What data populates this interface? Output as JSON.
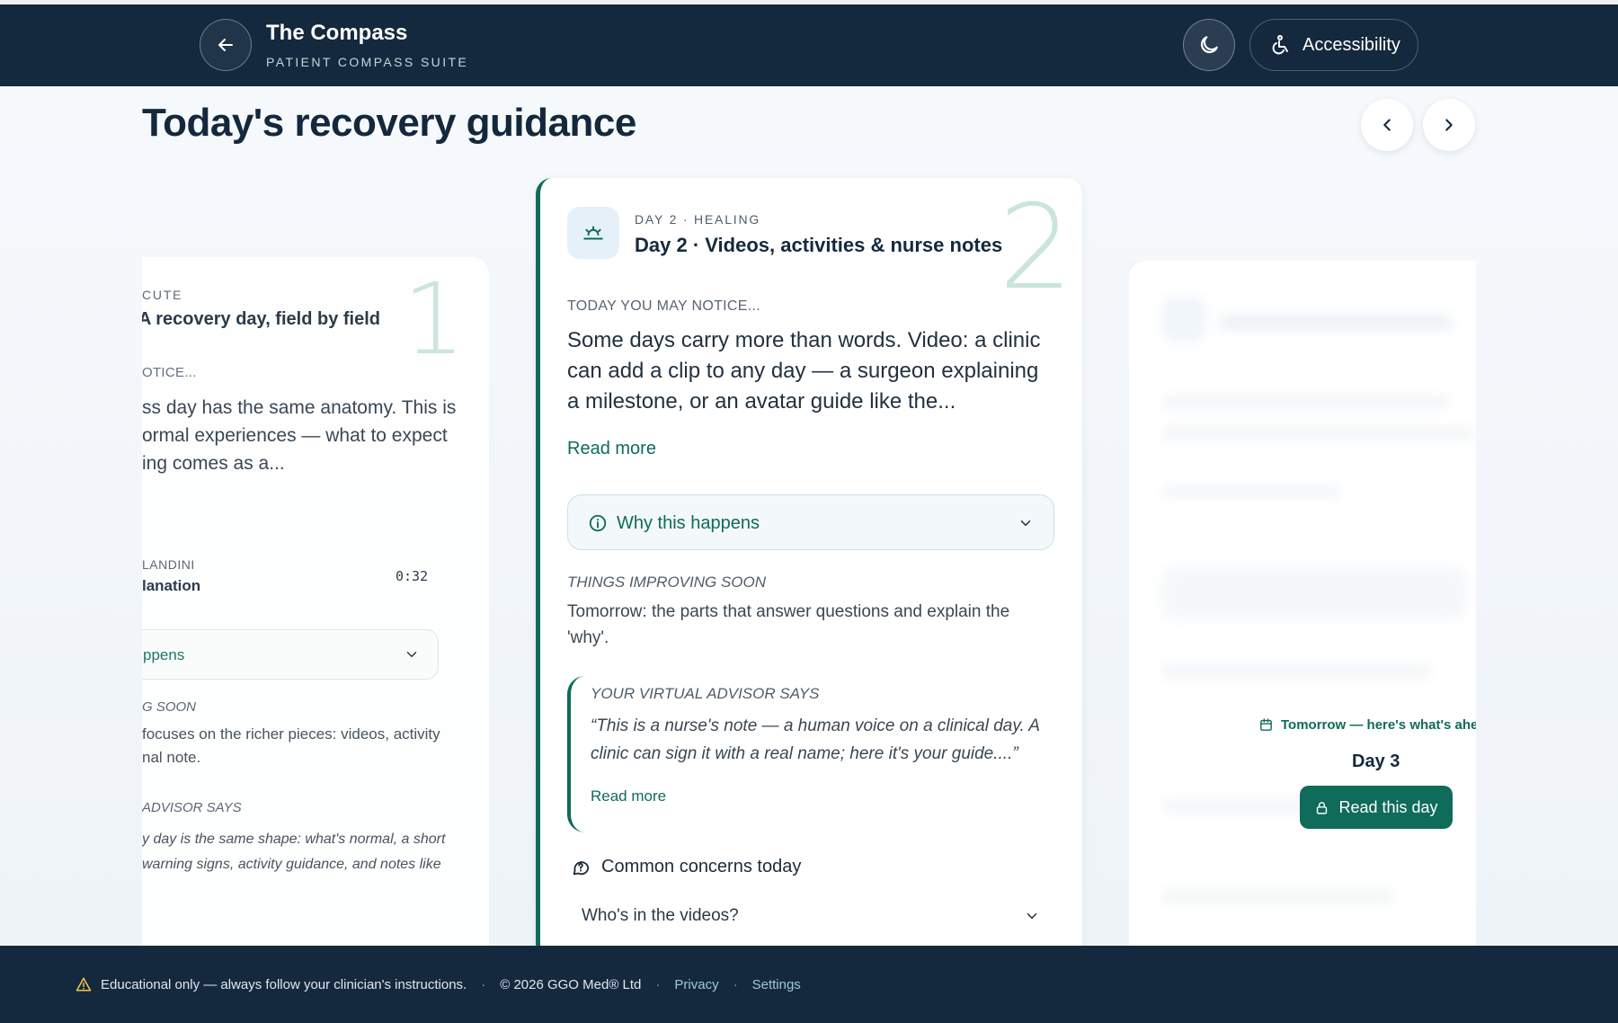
{
  "header": {
    "title": "The Compass",
    "subtitle": "PATIENT COMPASS SUITE",
    "accessibility_label": "Accessibility"
  },
  "page": {
    "title": "Today's recovery guidance"
  },
  "left_card": {
    "eyebrow": "CUTE",
    "title": "A recovery day, field by field",
    "big_number": "1",
    "notice_label": "OTICE...",
    "body_line1": "ss day has the same anatomy. This is",
    "body_line2": "ormal experiences — what to expect",
    "body_line3": "ing comes as a...",
    "video_author": "LANDINI",
    "video_title": "lanation",
    "video_time": "0:32",
    "why_label": "ppens",
    "improving_label": "G SOON",
    "improving_line1": "focuses on the richer pieces: videos, activity",
    "improving_line2": "nal note.",
    "advisor_label": "ADVISOR SAYS",
    "advisor_line1": "y day is the same shape: what's normal, a short",
    "advisor_line2": "warning signs, activity guidance, and notes like"
  },
  "center_card": {
    "eyebrow": "DAY 2 · HEALING",
    "title": "Day 2 · Videos, activities & nurse notes",
    "big_number": "2",
    "notice_label": "TODAY YOU MAY NOTICE...",
    "notice_text": "Some days carry more than words. Video: a clinic can add a clip to any day — a surgeon explaining a milestone, or an avatar guide like the...",
    "read_more": "Read more",
    "why_label": "Why this happens",
    "improving_label": "THINGS IMPROVING SOON",
    "improving_text": "Tomorrow: the parts that answer questions and explain the 'why'.",
    "advisor_label": "YOUR VIRTUAL ADVISOR SAYS",
    "advisor_quote": "“This is a nurse's note — a human voice on a clinical day. A clinic can sign it with a real name; here it's your guide....”",
    "advisor_read_more": "Read more",
    "concerns_label": "Common concerns today",
    "concern_1": "Who's in the videos?"
  },
  "right_card": {
    "tomorrow_label": "Tomorrow — here's what's ahe",
    "day_label": "Day 3",
    "read_button": "Read this day"
  },
  "footer": {
    "disclaimer": "Educational only — always follow your clinician's instructions.",
    "copyright": "© 2026 GGO Med® Ltd",
    "privacy": "Privacy",
    "settings": "Settings"
  },
  "colors": {
    "navy": "#14293e",
    "accent_green": "#0f6b5a",
    "warning_yellow": "#f2c94c"
  },
  "icons": {
    "back": "arrow-left-icon",
    "theme": "moon-icon",
    "accessibility": "accessibility-icon",
    "prev": "chevron-left-icon",
    "next": "chevron-right-icon",
    "day": "sunrise-icon",
    "info": "info-icon",
    "chat": "chat-bubble-icon",
    "calendar": "calendar-icon",
    "lock": "lock-icon",
    "warning": "warning-icon"
  }
}
